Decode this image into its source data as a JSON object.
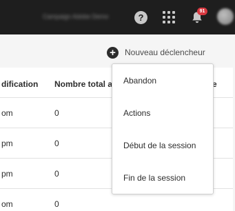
{
  "topbar": {
    "org_name": "Campaign Adobe Demo",
    "help_label": "?",
    "notification_count": "91"
  },
  "toolbar": {
    "new_trigger_label": "Nouveau déclencheur",
    "new_trigger_icon": "+"
  },
  "table": {
    "columns": [
      "dification",
      "Nombre total a",
      "e"
    ],
    "rows": [
      {
        "time": "om",
        "total": "0"
      },
      {
        "time": "pm",
        "total": "0"
      },
      {
        "time": "pm",
        "total": "0"
      },
      {
        "time": "om",
        "total": "0"
      }
    ]
  },
  "menu": {
    "items": [
      "Abandon",
      "Actions",
      "Début de la session",
      "Fin de la session"
    ]
  }
}
